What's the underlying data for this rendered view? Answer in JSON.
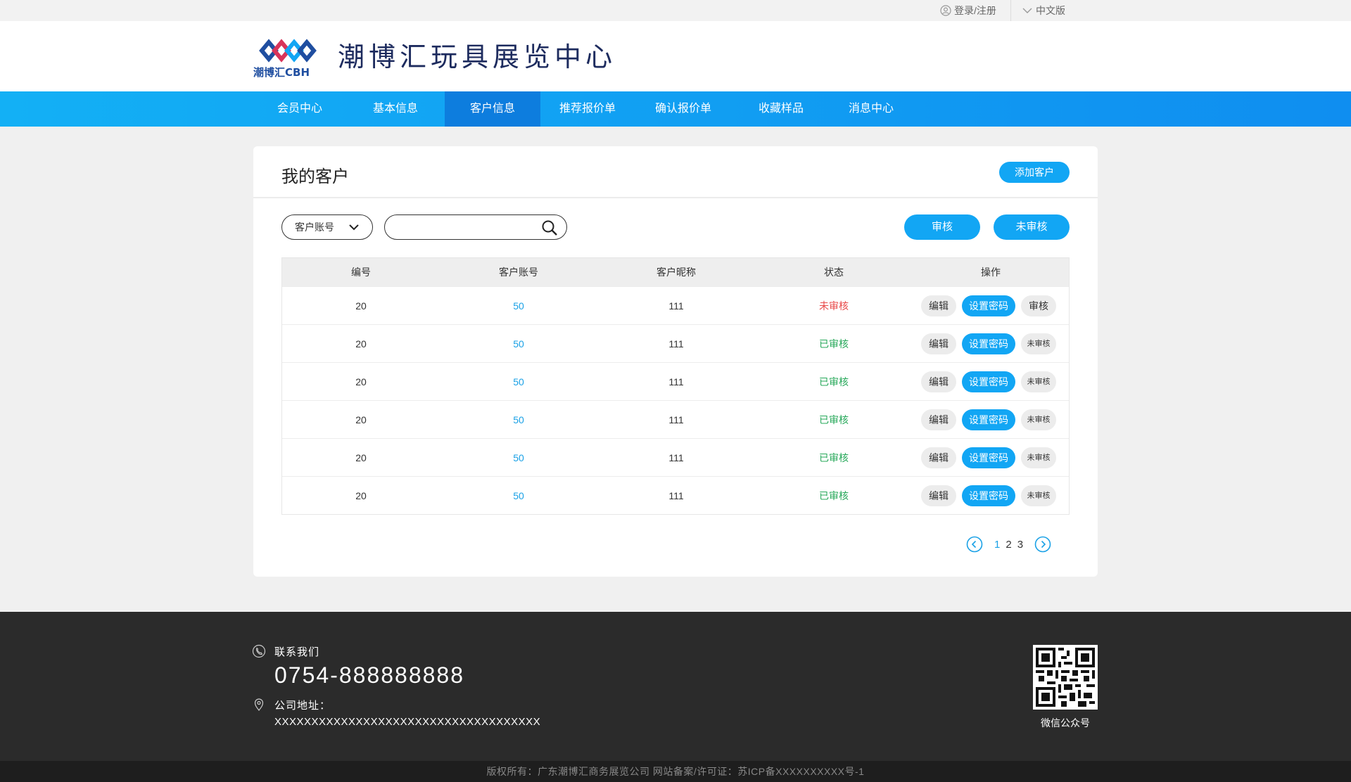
{
  "topbar": {
    "login_label": "登录/注册",
    "lang_label": "中文版"
  },
  "header": {
    "brand": "潮博汇玩具展览中心",
    "logo_text": "潮博汇CBH"
  },
  "nav": {
    "items": [
      {
        "label": "会员中心"
      },
      {
        "label": "基本信息"
      },
      {
        "label": "客户信息"
      },
      {
        "label": "推荐报价单"
      },
      {
        "label": "确认报价单"
      },
      {
        "label": "收藏样品"
      },
      {
        "label": "消息中心"
      }
    ]
  },
  "page": {
    "title": "我的客户",
    "add_button": "添加客户",
    "filter_select": "客户账号",
    "search_value": "",
    "filter_reviewed": "审核",
    "filter_unreviewed": "未审核"
  },
  "table": {
    "headers": [
      "编号",
      "客户账号",
      "客户昵称",
      "状态",
      "操作"
    ],
    "rows": [
      {
        "id": "20",
        "account": "50",
        "nickname": "111",
        "status": "未审核",
        "edit": "编辑",
        "set_password": "设置密码",
        "review_action": "审核"
      },
      {
        "id": "20",
        "account": "50",
        "nickname": "111",
        "status": "已审核",
        "edit": "编辑",
        "set_password": "设置密码",
        "review_action": "未审核"
      },
      {
        "id": "20",
        "account": "50",
        "nickname": "111",
        "status": "已审核",
        "edit": "编辑",
        "set_password": "设置密码",
        "review_action": "未审核"
      },
      {
        "id": "20",
        "account": "50",
        "nickname": "111",
        "status": "已审核",
        "edit": "编辑",
        "set_password": "设置密码",
        "review_action": "未审核"
      },
      {
        "id": "20",
        "account": "50",
        "nickname": "111",
        "status": "已审核",
        "edit": "编辑",
        "set_password": "设置密码",
        "review_action": "未审核"
      },
      {
        "id": "20",
        "account": "50",
        "nickname": "111",
        "status": "已审核",
        "edit": "编辑",
        "set_password": "设置密码",
        "review_action": "未审核"
      }
    ]
  },
  "pagination": {
    "pages": [
      "1",
      "2",
      "3"
    ],
    "current": "1"
  },
  "footer": {
    "contact_label": "联系我们",
    "phone": "0754-888888888",
    "address_label": "公司地址：",
    "address": "XXXXXXXXXXXXXXXXXXXXXXXXXXXXXXXXXXXX",
    "qr_label": "微信公众号",
    "copyright": "版权所有：广东潮博汇商务展览公司  网站备案/许可证：苏ICP备XXXXXXXXXX号-1"
  },
  "colors": {
    "accent": "#12a6f4",
    "nav_active": "#0d7dde",
    "status_unreviewed": "#e84a4a",
    "status_reviewed": "#27a85a",
    "footer_bg": "#2b2b2b"
  }
}
